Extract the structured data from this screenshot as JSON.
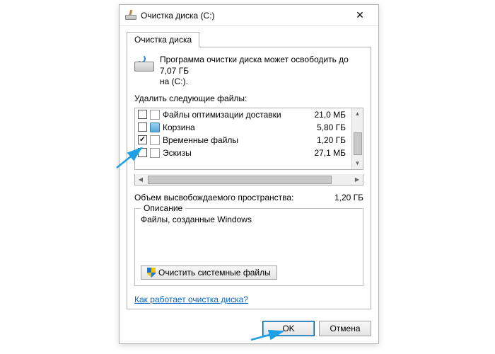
{
  "window": {
    "title": "Очистка диска  (C:)"
  },
  "tab": {
    "label": "Очистка диска"
  },
  "info": {
    "text_line1": "Программа очистки диска может освободить до 7,07 ГБ",
    "text_line2": "на  (C:)."
  },
  "list": {
    "label": "Удалить следующие файлы:",
    "items": [
      {
        "checked": false,
        "icon": "page",
        "name": "Файлы оптимизации доставки",
        "size": "21,0 МБ"
      },
      {
        "checked": false,
        "icon": "bin",
        "name": "Корзина",
        "size": "5,80 ГБ"
      },
      {
        "checked": true,
        "icon": "page",
        "name": "Временные файлы",
        "size": "1,20 ГБ"
      },
      {
        "checked": false,
        "icon": "page",
        "name": "Эскизы",
        "size": "27,1 МБ"
      }
    ]
  },
  "total": {
    "label": "Объем высвобождаемого пространства:",
    "value": "1,20 ГБ"
  },
  "description": {
    "title": "Описание",
    "body": "Файлы, созданные Windows"
  },
  "buttons": {
    "clean_system": "Очистить системные файлы",
    "ok": "OK",
    "cancel": "Отмена"
  },
  "link": {
    "text": "Как работает очистка диска?"
  }
}
